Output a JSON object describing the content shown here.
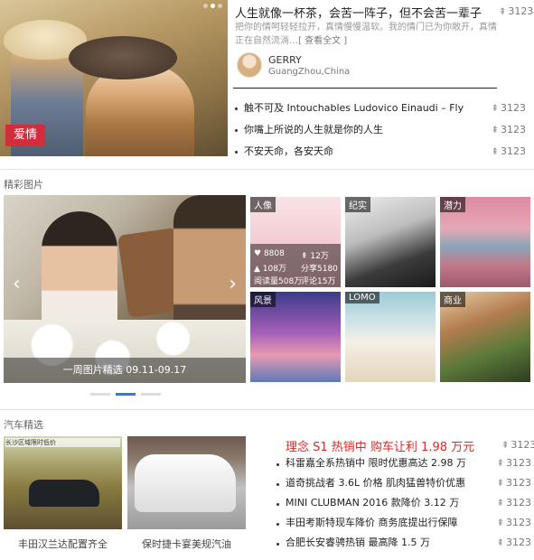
{
  "featured": {
    "tag": "爱情",
    "title": "人生就像一杯茶，会苦一阵子，但不会苦一辈子",
    "views": "3123",
    "description": "把你的情呵轻轻拉开，真情慢慢温软。我的情门已为你敞开，真情正在自然流淌…",
    "more_link": "[ 查看全文 ]",
    "author_name": "GERRY",
    "author_location": "GuangZhou,China"
  },
  "top_list": [
    {
      "title": "触不可及 Intouchables Ludovico Einaudi – Fly",
      "views": "3123"
    },
    {
      "title": "你嘴上所说的人生就是你的人生",
      "views": "3123"
    },
    {
      "title": "不安天命，各安天命",
      "views": "3123"
    }
  ],
  "photos": {
    "section_title": "精彩图片",
    "slide_caption": "一周图片精选 09.11-09.17",
    "prev_arrow": "‹",
    "next_arrow": "›",
    "tiles": [
      {
        "label": "人像"
      },
      {
        "label": "纪实"
      },
      {
        "label": "潜力"
      },
      {
        "label": "风景"
      },
      {
        "label": "LOMO"
      },
      {
        "label": "商业"
      }
    ],
    "stats": {
      "likes": "8808",
      "views": "12万",
      "fans": "108万",
      "shares": "分享5180",
      "reads": "阅读量508万",
      "comments": "评论15万"
    }
  },
  "cars": {
    "section_title": "汽车精选",
    "image1_caption": "丰田汉兰达配置齐全",
    "image2_caption": "保时捷卡宴美规汽油",
    "image1_band": "长沙区域限时低价",
    "headline": "理念 S1 热销中 购车让利 1.98 万元",
    "headline_views": "3123",
    "items": [
      {
        "title": "科雷嘉全系热销中 限时优惠高达 2.98 万",
        "views": "3123"
      },
      {
        "title": "道奇挑战者 3.6L 价格 肌肉猛兽特价优惠",
        "views": "3123"
      },
      {
        "title": "MINI CLUBMAN 2016 款降价 3.12 万",
        "views": "3123"
      },
      {
        "title": "丰田考斯特现车降价 商务底提出行保障",
        "views": "3123"
      },
      {
        "title": "合肥长安睿骋热销 最高降 1.5 万",
        "views": "3123"
      }
    ]
  },
  "icons": {
    "views_glyph": "⇞"
  }
}
